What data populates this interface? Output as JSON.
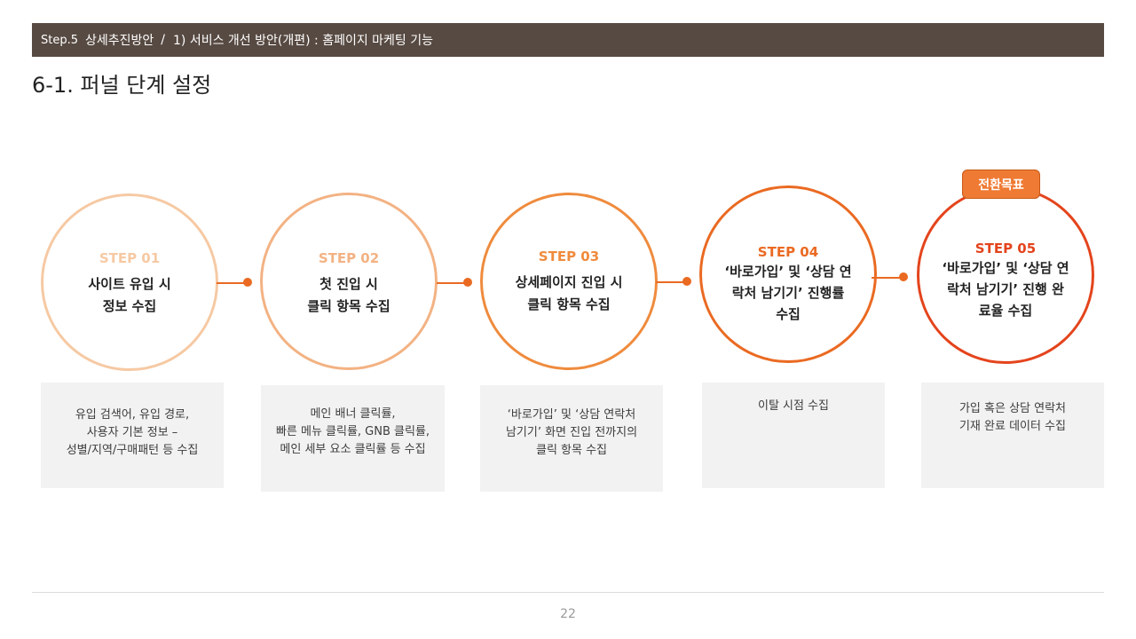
{
  "header": {
    "step": "Step.5",
    "section": "상세추진방안",
    "separator": "/",
    "subtitle": "1) 서비스 개선 방안(개편) : 홈페이지 마케팅 기능"
  },
  "page_title": "6-1. 퍼널 단계 설정",
  "goal_badge": "전환목표",
  "steps": [
    {
      "label": "STEP 01",
      "desc": [
        "사이트 유입 시",
        "정보 수집"
      ],
      "details": [
        "유입 검색어, 유입 경로,",
        "사용자 기본 정보 –",
        "성별/지역/구매패턴 등 수집"
      ],
      "color": "#f6c9a3"
    },
    {
      "label": "STEP 02",
      "desc": [
        "첫 진입 시",
        "클릭 항목 수집"
      ],
      "details": [
        "메인 배너 클릭률,",
        "빠른 메뉴 클릭률, GNB 클릭률,",
        "메인 세부 요소 클릭률 등 수집"
      ],
      "color": "#f3b283"
    },
    {
      "label": "STEP 03",
      "desc": [
        "상세페이지 진입 시",
        "클릭 항목 수집"
      ],
      "details": [
        "‘바로가입’ 및 ‘상담 연락처",
        "남기기’ 화면 진입 전까지의",
        "클릭 항목 수집"
      ],
      "color": "#ef8b3d"
    },
    {
      "label": "STEP 04",
      "desc": [
        "‘바로가입’ 및 ‘상담 연",
        "락처 남기기’ 진행률",
        "수집"
      ],
      "details": [
        "이탈 시점 수집"
      ],
      "color": "#ea6a22"
    },
    {
      "label": "STEP 05",
      "desc": [
        "‘바로가입’ 및 ‘상담 연",
        "락처 남기기’ 진행 완",
        "료율 수집"
      ],
      "details": [
        "가입 혹은 상담 연락처",
        "기재 완료 데이터 수집"
      ],
      "color": "#e4441c"
    }
  ],
  "connector_color": "#ea6a22",
  "page_number": "22"
}
